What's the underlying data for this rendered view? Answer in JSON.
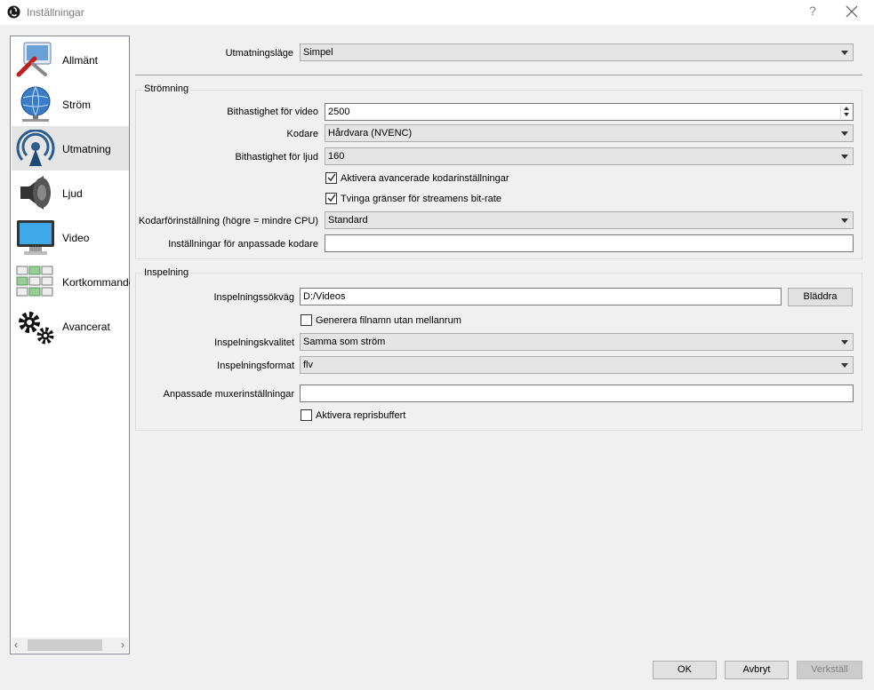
{
  "window": {
    "title": "Inställningar",
    "help": "?",
    "close_icon": "close-icon",
    "app_icon": "obs-logo-icon"
  },
  "sidebar": {
    "items": [
      {
        "label": "Allmänt",
        "icon": "general-wrench-icon"
      },
      {
        "label": "Ström",
        "icon": "globe-network-icon"
      },
      {
        "label": "Utmatning",
        "icon": "broadcast-antenna-icon",
        "active": true
      },
      {
        "label": "Ljud",
        "icon": "speaker-icon"
      },
      {
        "label": "Video",
        "icon": "monitor-icon"
      },
      {
        "label": "Kortkommandon",
        "icon": "keyboard-hotkeys-icon"
      },
      {
        "label": "Avancerat",
        "icon": "gears-icon"
      }
    ],
    "scroll_left": "‹",
    "scroll_right": "›"
  },
  "output_mode": {
    "label": "Utmatningsläge",
    "value": "Simpel"
  },
  "streaming": {
    "title": "Strömning",
    "video_bitrate": {
      "label": "Bithastighet för video",
      "value": "2500"
    },
    "encoder": {
      "label": "Kodare",
      "value": "Hårdvara (NVENC)"
    },
    "audio_bitrate": {
      "label": "Bithastighet för ljud",
      "value": "160"
    },
    "advanced_encoder": {
      "label": "Aktivera avancerade kodarinställningar",
      "checked": true
    },
    "enforce_limits": {
      "label": "Tvinga gränser för streamens bit-rate",
      "checked": true
    },
    "preset": {
      "label": "Kodarförinställning (högre = mindre CPU)",
      "value": "Standard"
    },
    "custom_encoder": {
      "label": "Inställningar för anpassade kodare",
      "value": ""
    }
  },
  "recording": {
    "title": "Inspelning",
    "path": {
      "label": "Inspelningssökväg",
      "value": "D:/Videos",
      "browse": "Bläddra"
    },
    "no_space": {
      "label": "Generera filnamn utan mellanrum",
      "checked": false
    },
    "quality": {
      "label": "Inspelningskvalitet",
      "value": "Samma som ström"
    },
    "format": {
      "label": "Inspelningsformat",
      "value": "flv"
    },
    "muxer": {
      "label": "Anpassade muxerinställningar",
      "value": ""
    },
    "replay_buffer": {
      "label": "Aktivera reprisbuffert",
      "checked": false
    }
  },
  "buttons": {
    "ok": "OK",
    "cancel": "Avbryt",
    "apply": "Verkställ"
  }
}
